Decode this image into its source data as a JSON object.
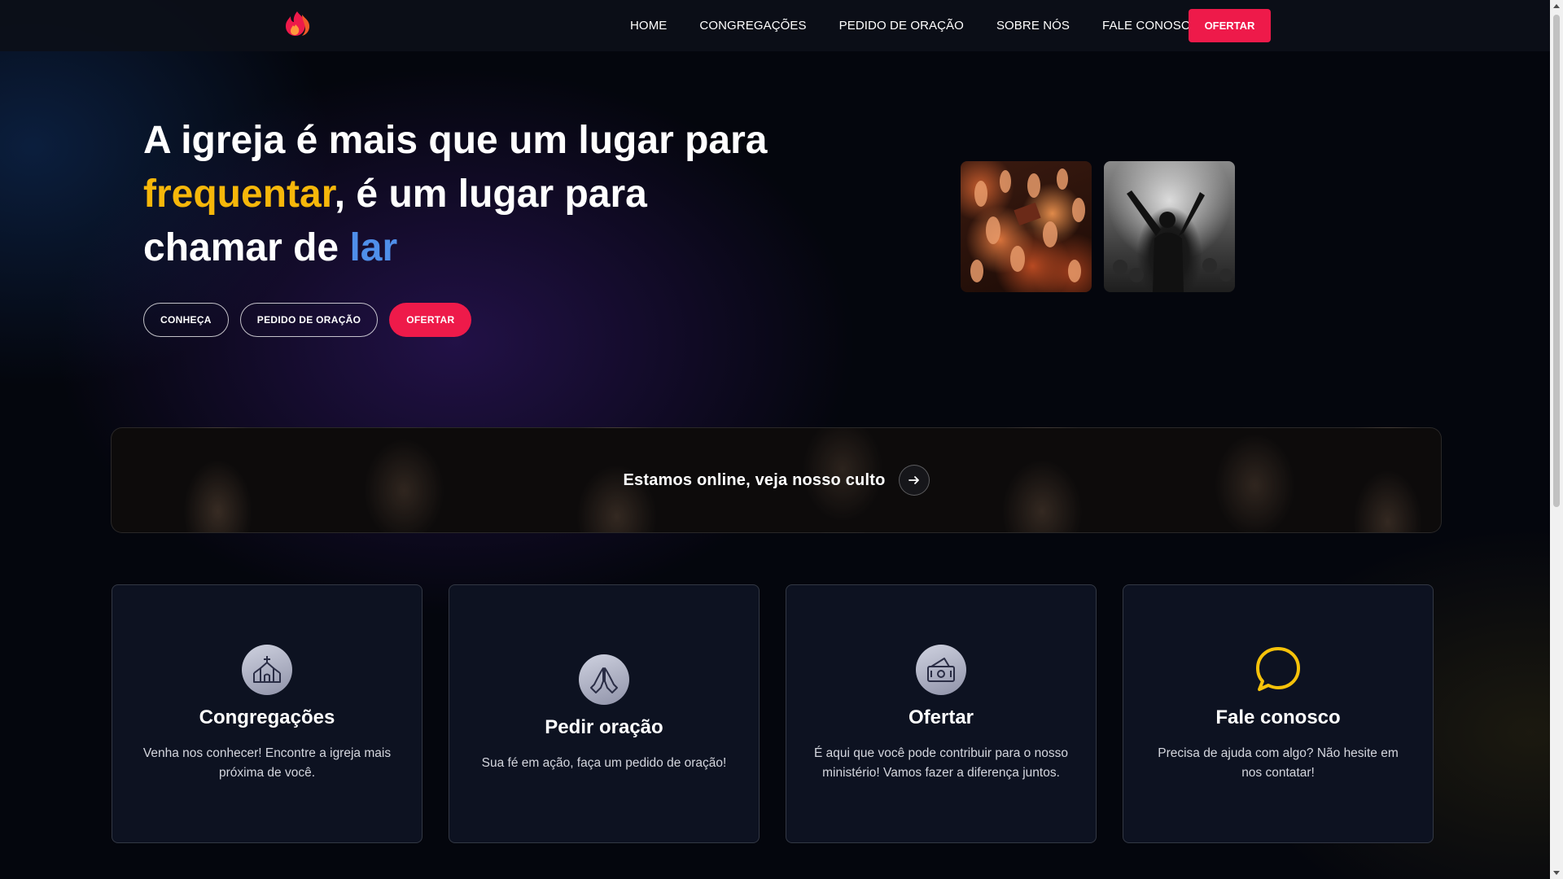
{
  "nav": {
    "logo_icon": "flame-icon",
    "links": [
      {
        "label": "HOME"
      },
      {
        "label": "CONGREGAÇÕES"
      },
      {
        "label": "PEDIDO DE ORAÇÃO"
      },
      {
        "label": "SOBRE NÓS"
      },
      {
        "label": "FALE CONOSCO"
      }
    ],
    "cta_label": "OFERTAR"
  },
  "hero": {
    "title_part1": "A igreja é mais que um lugar para ",
    "title_highlight1": "frequentar",
    "title_part2": ", é um lugar para chamar de ",
    "title_highlight2": "lar",
    "buttons": [
      {
        "label": "CONHEÇA"
      },
      {
        "label": "PEDIDO DE ORAÇÃO"
      },
      {
        "label": "OFERTAR"
      }
    ]
  },
  "live": {
    "text": "Estamos online, veja nosso culto",
    "arrow_icon": "arrow-right-icon"
  },
  "cards": [
    {
      "icon": "church-icon",
      "title": "Congregações",
      "text": "Venha nos conhecer! Encontre a igreja mais próxima de você."
    },
    {
      "icon": "praying-hands-icon",
      "title": "Pedir oração",
      "text": "Sua fé em ação, faça um pedido de oração!"
    },
    {
      "icon": "money-icon",
      "title": "Ofertar",
      "text": "É aqui que você pode contribuir para o nosso ministério! Vamos fazer a diferença juntos."
    },
    {
      "icon": "chat-bubble-icon",
      "title": "Fale conosco",
      "text": "Precisa de ajuda com algo? Não hesite em nos contatar!"
    }
  ],
  "colors": {
    "accent_red": "#ee1a4a",
    "highlight_yellow": "#f6b70a",
    "highlight_blue": "#4f8fea",
    "background": "#04060d",
    "card_background": "#0d1221"
  }
}
